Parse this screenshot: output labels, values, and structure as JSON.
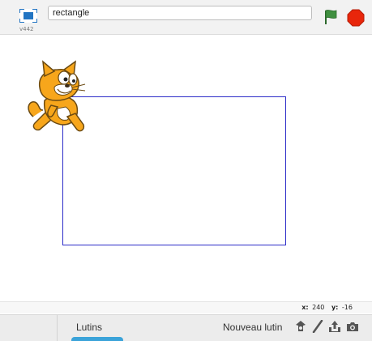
{
  "app": {
    "version": "v442",
    "project_title": "rectangle",
    "colors": {
      "flag_green": "#3f8f3f",
      "stop_red": "#e8260b",
      "rectangle_stroke": "#2c2cc8",
      "cat_orange": "#f7a61b",
      "accent_blue": "#3ba3d9"
    }
  },
  "toolbar": {
    "stage_mode_icon": "presentation-mode-icon",
    "green_flag_icon": "green-flag-icon",
    "stop_icon": "stop-sign-icon"
  },
  "stage": {
    "sprite_name": "scratch-cat",
    "drawn_shape": "rectangle"
  },
  "coordinates": {
    "x_label": "x:",
    "x_value": "240",
    "y_label": "y:",
    "y_value": "-16"
  },
  "sprites_panel": {
    "title": "Lutins",
    "new_sprite_label": "Nouveau lutin",
    "tools": [
      "choose-from-library-icon",
      "paint-new-sprite-icon",
      "upload-sprite-icon",
      "camera-icon"
    ]
  }
}
